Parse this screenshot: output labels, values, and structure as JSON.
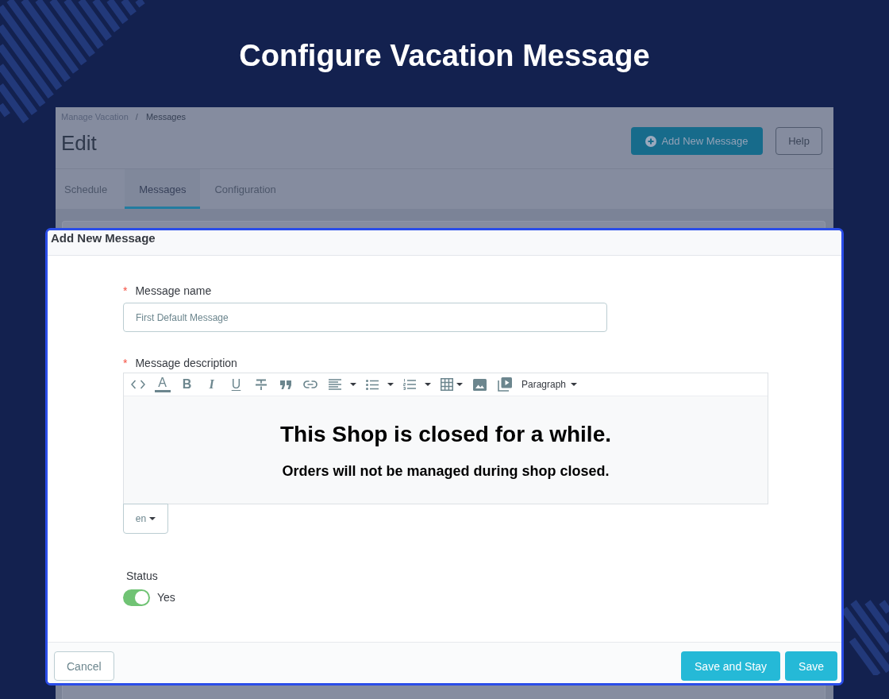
{
  "page": {
    "title": "Configure Vacation Message"
  },
  "app": {
    "breadcrumb": {
      "items": [
        "Manage Vacation",
        "Messages"
      ],
      "separator": "/"
    },
    "heading": "Edit",
    "actions": [
      {
        "label": "Add New Message",
        "kind": "primary"
      },
      {
        "label": "Help",
        "kind": "outline"
      }
    ],
    "tabs": [
      {
        "label": "Schedule",
        "selected": false
      },
      {
        "label": "Messages",
        "selected": true
      },
      {
        "label": "Configuration",
        "selected": false
      }
    ]
  },
  "modal": {
    "title": "Add New Message",
    "name_field": {
      "required_mark": "*",
      "label": "Message name",
      "value": "First Default Message"
    },
    "description_field": {
      "required_mark": "*",
      "label": "Message description",
      "toolbar": {
        "text_color": "A",
        "bold": "B",
        "italic": "I",
        "underline": "U",
        "block_format": "Paragraph"
      },
      "content": [
        {
          "kind": "heading",
          "text": "This Shop is closed for a while."
        },
        {
          "kind": "subheading",
          "text": "Orders will not be managed during shop closed."
        }
      ],
      "language": "en"
    },
    "status": {
      "label": "Status",
      "on": true,
      "value_label": "Yes"
    },
    "footer_buttons": [
      {
        "label": "Cancel",
        "kind": "secondary"
      },
      {
        "label": "Save and Stay",
        "kind": "primary"
      },
      {
        "label": "Save",
        "kind": "primary"
      }
    ]
  }
}
